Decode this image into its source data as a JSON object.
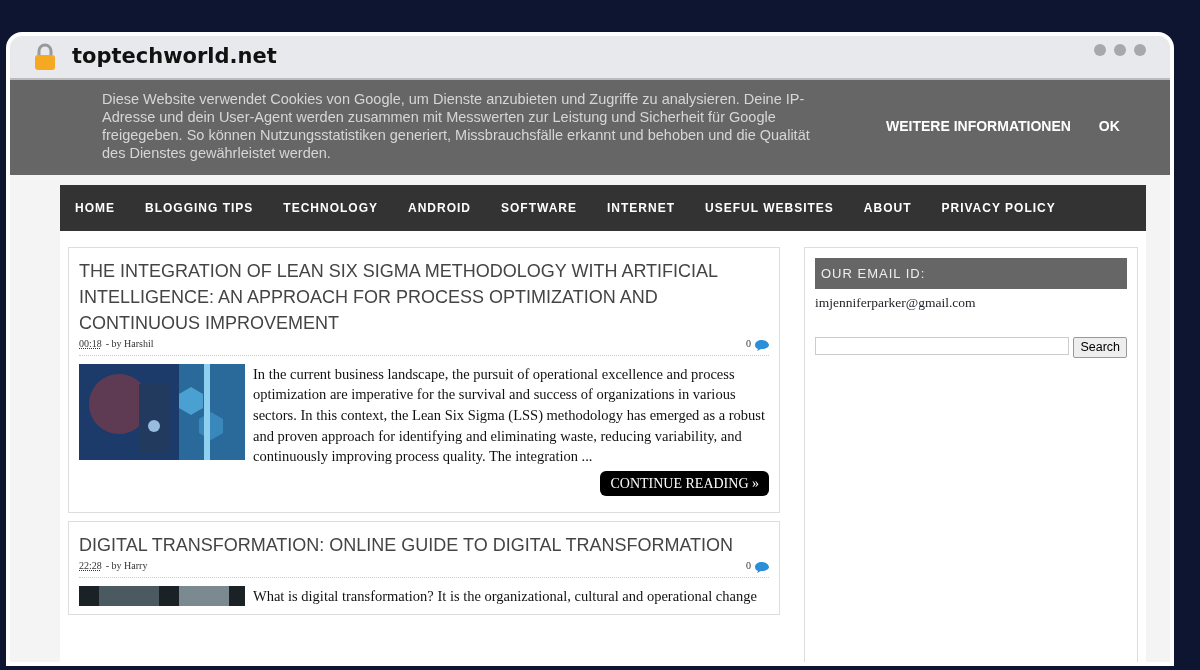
{
  "browser": {
    "address": "toptechworld.net"
  },
  "cookie_banner": {
    "message": "Diese Website verwendet Cookies von Google, um Dienste anzubieten und Zugriffe zu analysieren. Deine IP-Adresse und dein User-Agent werden zusammen mit Messwerten zur Leistung und Sicherheit für Google freigegeben. So können Nutzungsstatistiken generiert, Missbrauchsfälle erkannt und behoben und die Qualität des Dienstes gewährleistet werden.",
    "buttons": [
      "WEITERE INFORMATIONEN",
      "OK"
    ]
  },
  "nav": [
    "HOME",
    "BLOGGING TIPS",
    "TECHNOLOGY",
    "ANDROID",
    "SOFTWARE",
    "INTERNET",
    "USEFUL WEBSITES",
    "ABOUT",
    "PRIVACY POLICY"
  ],
  "posts": [
    {
      "title": "THE INTEGRATION OF LEAN SIX SIGMA METHODOLOGY WITH ARTIFICIAL INTELLIGENCE: AN APPROACH FOR PROCESS OPTIMIZATION AND CONTINUOUS IMPROVEMENT",
      "comments": "0",
      "time": "00:18",
      "byline": "- by Harshil",
      "excerpt": "In the current business landscape, the pursuit of operational excellence and process optimization are imperative for the survival and success of organizations in various sectors. In this context, the Lean Six Sigma (LSS) methodology has emerged as a robust and proven approach for identifying and eliminating waste, reducing variability, and continuously improving process quality. The integration ...",
      "more": "CONTINUE READING »"
    },
    {
      "title": "DIGITAL TRANSFORMATION: ONLINE GUIDE TO DIGITAL TRANSFORMATION",
      "comments": "0",
      "time": "22:28",
      "byline": "- by Harry",
      "excerpt": "What is digital transformation? It is the organizational, cultural and operational change"
    }
  ],
  "sidebar": {
    "heading": "OUR EMAIL ID:",
    "email": "imjenniferparker@gmail.com",
    "search_button": "Search"
  }
}
